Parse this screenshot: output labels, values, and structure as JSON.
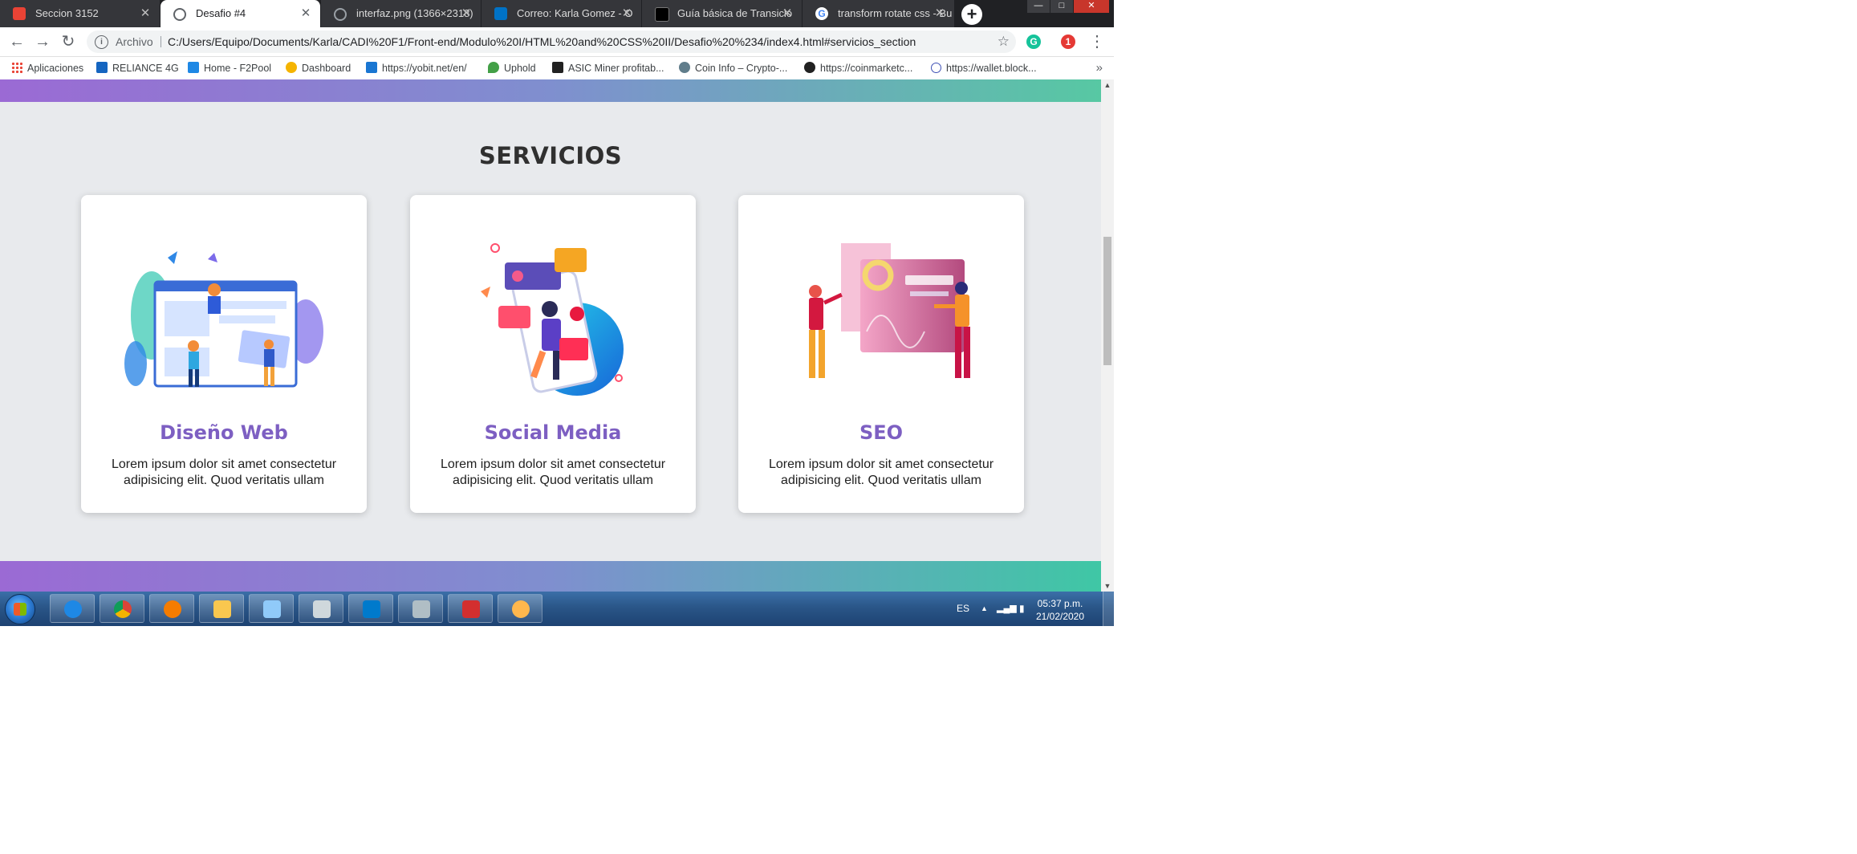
{
  "browser": {
    "tabs": [
      {
        "title": "Seccion 3152",
        "icon": "gmod-icon",
        "color": "#e94335"
      },
      {
        "title": "Desafio #4",
        "icon": "globe-icon",
        "color": "#5f6368"
      },
      {
        "title": "interfaz.png (1366×2318)",
        "icon": "globe-icon",
        "color": "#9aa0a6"
      },
      {
        "title": "Correo: Karla Gomez - O",
        "icon": "outlook-icon",
        "color": "#0072c6"
      },
      {
        "title": "Guía básica de Transicio",
        "icon": "fm-icon",
        "color": "#000000"
      },
      {
        "title": "transform rotate css - Bu",
        "icon": "google-icon",
        "color": "#4285f4"
      }
    ],
    "new_tab_label": "+",
    "window_controls": {
      "minimize": "—",
      "maximize": "□",
      "close": "✕"
    },
    "address": {
      "scheme_label": "Archivo",
      "url": "C:/Users/Equipo/Documents/Karla/CADI%20F1/Front-end/Modulo%20I/HTML%20and%20CSS%20II/Desafio%20%234/index4.html#servicios_section"
    },
    "bookmarks": [
      {
        "label": "Aplicaciones",
        "icon": "apps-grid-icon",
        "color": "#e94335"
      },
      {
        "label": "RELIANCE 4G",
        "icon": "reliance-icon",
        "color": "#1565c0"
      },
      {
        "label": "Home - F2Pool",
        "icon": "f2pool-icon",
        "color": "#1e88e5"
      },
      {
        "label": "Dashboard",
        "icon": "dashboard-icon",
        "color": "#f5b400"
      },
      {
        "label": "https://yobit.net/en/",
        "icon": "yobit-icon",
        "color": "#1976d2"
      },
      {
        "label": "Uphold",
        "icon": "uphold-icon",
        "color": "#43a047"
      },
      {
        "label": "ASIC Miner profitab...",
        "icon": "asic-icon",
        "color": "#212121"
      },
      {
        "label": "Coin Info – Crypto-...",
        "icon": "coininfo-icon",
        "color": "#607d8b"
      },
      {
        "label": "https://coinmarketc...",
        "icon": "coinmarketcap-icon",
        "color": "#212121"
      },
      {
        "label": "https://wallet.block...",
        "icon": "blockchain-icon",
        "color": "#3f51b5"
      }
    ],
    "bookmarks_more": "»"
  },
  "page": {
    "section_title": "SERVICIOS",
    "cards": [
      {
        "title": "Diseño Web",
        "text": "Lorem ipsum dolor sit amet consectetur adipisicing elit. Quod veritatis ullam",
        "illustration": "web-design-illustration"
      },
      {
        "title": "Social Media",
        "text": "Lorem ipsum dolor sit amet consectetur adipisicing elit. Quod veritatis ullam",
        "illustration": "social-media-illustration"
      },
      {
        "title": "SEO",
        "text": "Lorem ipsum dolor sit amet consectetur adipisicing elit. Quod veritatis ullam",
        "illustration": "seo-illustration"
      }
    ],
    "colors": {
      "accent": "#7d5fc2",
      "gradient_start": "#9b6ad4",
      "gradient_end": "#57c8a3",
      "background": "#e8eaed"
    }
  },
  "taskbar": {
    "apps": [
      {
        "icon": "internet-explorer-icon",
        "color": "#1e88e5"
      },
      {
        "icon": "chrome-icon",
        "color": "#db4437"
      },
      {
        "icon": "media-player-icon",
        "color": "#f57c00"
      },
      {
        "icon": "file-explorer-icon",
        "color": "#f9c74f"
      },
      {
        "icon": "notepad-icon",
        "color": "#90caf9"
      },
      {
        "icon": "calculator-icon",
        "color": "#cfd8dc"
      },
      {
        "icon": "vscode-icon",
        "color": "#007acc"
      },
      {
        "icon": "paint-icon",
        "color": "#b0bec5"
      },
      {
        "icon": "acrobat-icon",
        "color": "#d32f2f"
      },
      {
        "icon": "paint-palette-icon",
        "color": "#ffb74d"
      }
    ],
    "language": "ES",
    "time": "05:37 p.m.",
    "date": "21/02/2020"
  }
}
